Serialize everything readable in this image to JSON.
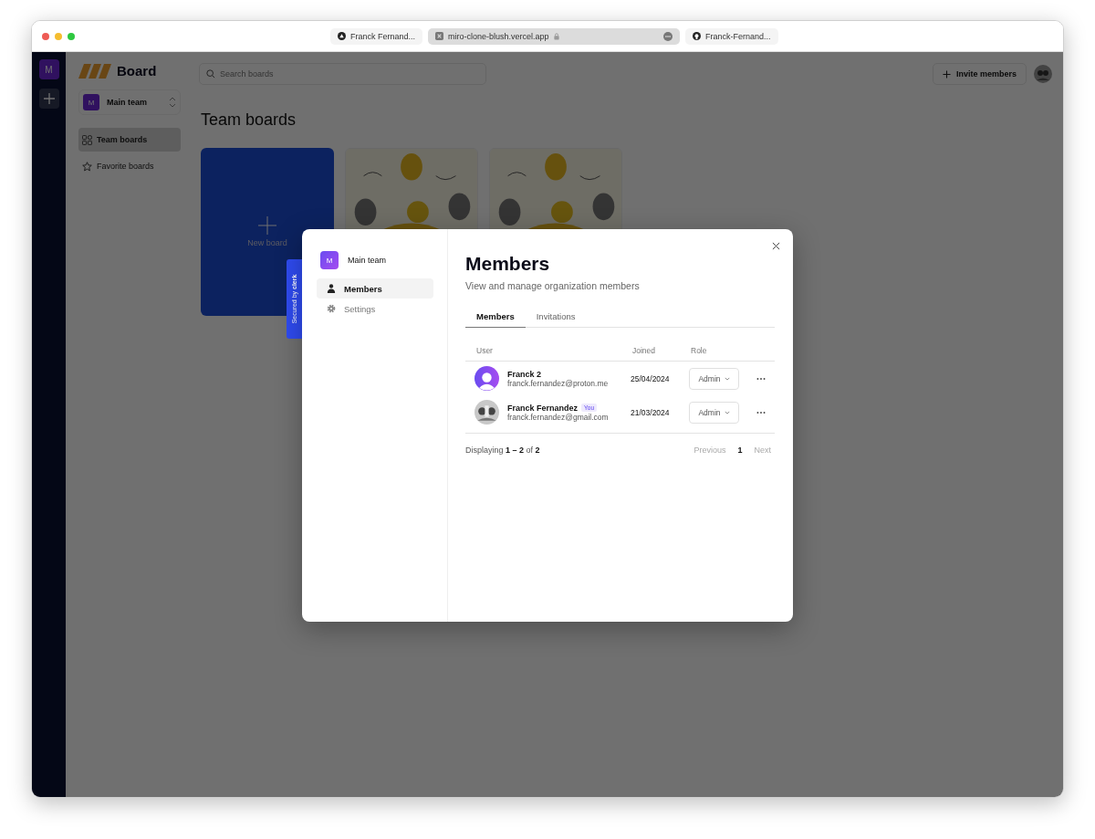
{
  "browser": {
    "tabs": [
      {
        "label": "Franck Fernand...",
        "selected": false
      },
      {
        "label": "miro-clone-blush.vercel.app",
        "selected": true
      },
      {
        "label": "Franck-Fernand...",
        "selected": false
      }
    ]
  },
  "rail": {
    "team_initial": "M"
  },
  "sidebar": {
    "logo": "Board",
    "team": {
      "initial": "M",
      "name": "Main team"
    },
    "items": [
      {
        "label": "Team boards",
        "selected": true
      },
      {
        "label": "Favorite boards",
        "selected": false
      }
    ]
  },
  "header": {
    "search": {
      "placeholder": "Search boards"
    },
    "invite_button": "Invite members"
  },
  "page_title": "Team boards",
  "boards": [
    {
      "kind": "new",
      "label": "New board"
    },
    {
      "kind": "picture"
    },
    {
      "kind": "picture"
    }
  ],
  "clerk_badge": {
    "prefix": "Secured by",
    "brand": "clerk"
  },
  "modal": {
    "org": {
      "initial": "M",
      "name": "Main team"
    },
    "nav": [
      {
        "label": "Members",
        "selected": true
      },
      {
        "label": "Settings",
        "selected": false
      }
    ],
    "title": "Members",
    "subtitle": "View and manage organization members",
    "tabs": [
      {
        "label": "Members",
        "selected": true
      },
      {
        "label": "Invitations",
        "selected": false
      }
    ],
    "columns": [
      "User",
      "Joined",
      "Role"
    ],
    "rows": [
      {
        "name": "Franck 2",
        "email": "franck.fernandez@proton.me",
        "joined": "25/04/2024",
        "role": "Admin"
      },
      {
        "name": "Franck Fernandez",
        "badge": "You",
        "email": "franck.fernandez@gmail.com",
        "joined": "21/03/2024",
        "role": "Admin"
      }
    ],
    "footer": "Displaying **1 – 2** of **2**",
    "pagination": {
      "previous": {
        "label": "Previous",
        "disabled": true
      },
      "page": "1",
      "next": {
        "label": "Next",
        "disabled": true
      }
    }
  }
}
